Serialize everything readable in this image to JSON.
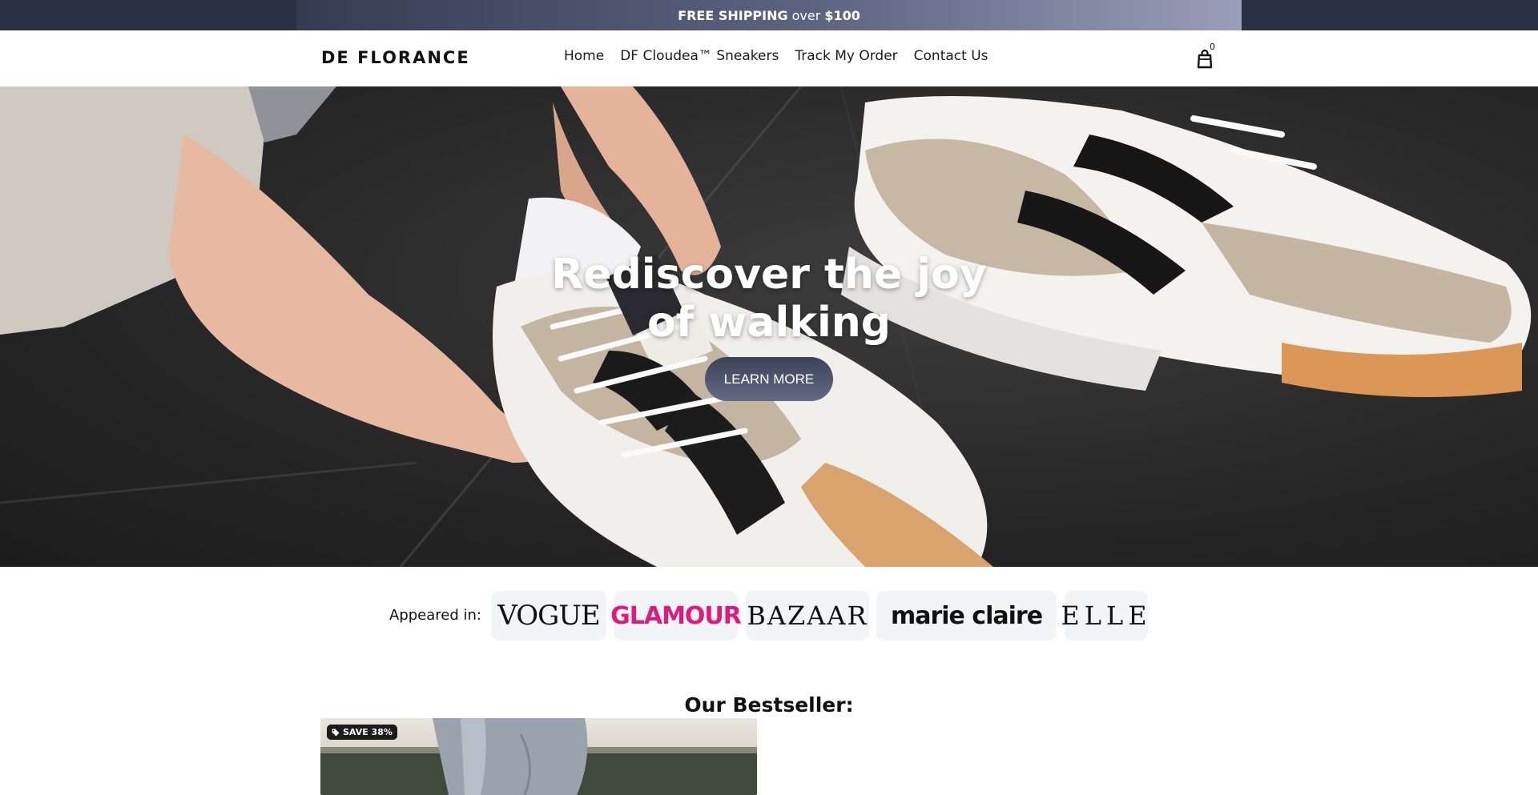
{
  "announcement": {
    "free_shipping": "FREE SHIPPING",
    "over": "over",
    "amount": "$100"
  },
  "header": {
    "logo": "DE FLORANCE",
    "nav": [
      {
        "label": "Home"
      },
      {
        "label": "DF Cloudea™ Sneakers"
      },
      {
        "label": "Track My Order"
      },
      {
        "label": "Contact Us"
      }
    ],
    "cart_count": "0",
    "cart_icon": "shopping-bag-icon"
  },
  "hero": {
    "title": "Rediscover the joy of walking",
    "button_label": "LEARN MORE"
  },
  "press": {
    "label": "Appeared in:",
    "logos": [
      "VOGUE",
      "GLAMOUR",
      "BAZAAR",
      "marie claire",
      "ELLE"
    ]
  },
  "bestseller": {
    "title": "Our Bestseller:",
    "badge": "SAVE 38%",
    "badge_icon": "tag-icon"
  },
  "colors": {
    "announce_bg": "#293143",
    "button_gradient_start": "#3a4158",
    "button_gradient_end": "#656b85",
    "glamour_pink": "#e0197d"
  }
}
